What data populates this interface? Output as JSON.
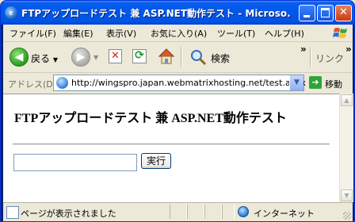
{
  "window": {
    "title": "FTPアップロードテスト 兼 ASP.NET動作テスト - Microso..."
  },
  "menu": {
    "items": [
      "ファイル(F)",
      "編集(E)",
      "表示(V)",
      "お気に入り(A)",
      "ツール(T)",
      "ヘルプ(H)"
    ]
  },
  "toolbar": {
    "back_label": "戻る",
    "search_label": "検索",
    "links_label": "リンク",
    "chevron": "»"
  },
  "address": {
    "label": "アドレス(D)",
    "url": "http://wingspro.japan.webmatrixhosting.net/test.aspx",
    "go_label": "移動"
  },
  "page": {
    "heading": "FTPアップロードテスト 兼 ASP.NET動作テスト",
    "input_value": "",
    "submit_label": "実行"
  },
  "status": {
    "text": "ページが表示されました",
    "zone": "インターネット"
  },
  "colors": {
    "titlebar": "#0054e3",
    "chrome": "#ece9d8",
    "close_button": "#c73a16"
  }
}
